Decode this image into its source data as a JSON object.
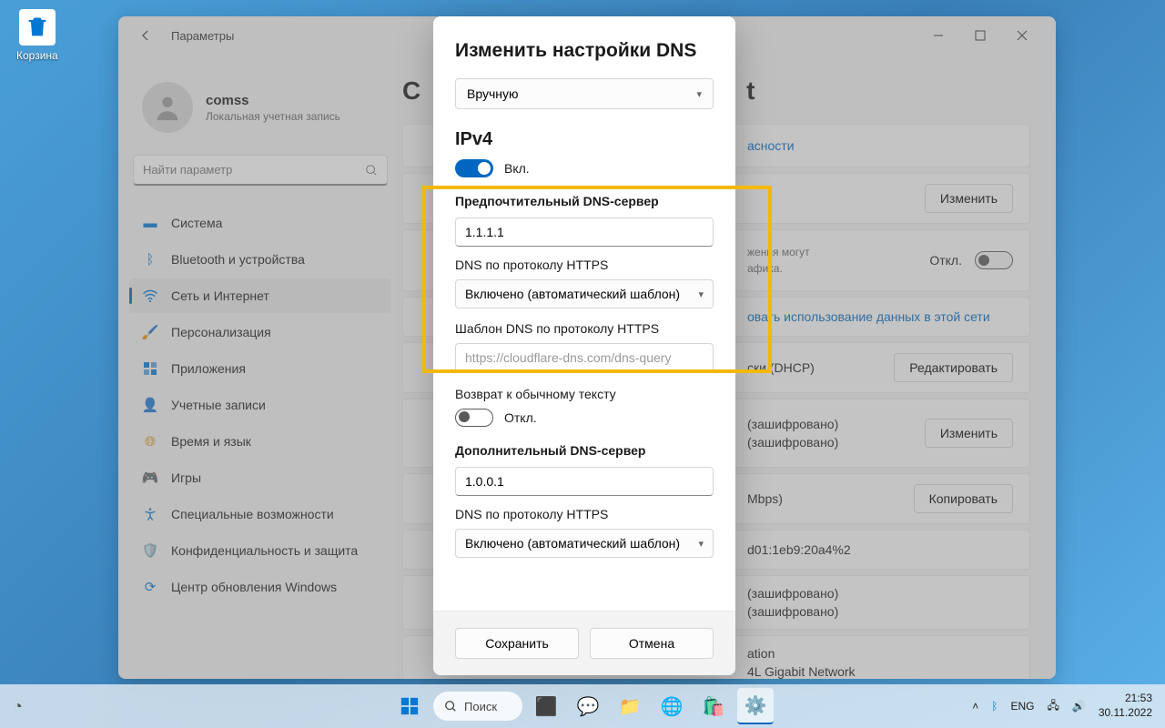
{
  "desktop": {
    "recycle_bin": "Корзина"
  },
  "window": {
    "title": "Параметры",
    "user": {
      "name": "comss",
      "subtitle": "Локальная учетная запись"
    },
    "search_placeholder": "Найти параметр",
    "nav": [
      {
        "label": "Система",
        "icon": "🖥️"
      },
      {
        "label": "Bluetooth и устройства",
        "icon": "bt"
      },
      {
        "label": "Сеть и Интернет",
        "icon": "wifi",
        "active": true
      },
      {
        "label": "Персонализация",
        "icon": "🖌️"
      },
      {
        "label": "Приложения",
        "icon": "apps"
      },
      {
        "label": "Учетные записи",
        "icon": "👤"
      },
      {
        "label": "Время и язык",
        "icon": "🌐"
      },
      {
        "label": "Игры",
        "icon": "🎮"
      },
      {
        "label": "Специальные возможности",
        "icon": "acc"
      },
      {
        "label": "Конфиденциальность и защита",
        "icon": "🛡️"
      },
      {
        "label": "Центр обновления Windows",
        "icon": "upd"
      }
    ],
    "page_title_partial": "C",
    "bg": {
      "security_link": "асности",
      "edit1": "Изменить",
      "metered_sub1": "жения могут",
      "metered_sub2": "афика.",
      "off_label": "Откл.",
      "data_usage_link": "овать использование данных в этой сети",
      "dhcp_label": "ски (DHCP)",
      "edit_btn": "Редактировать",
      "encrypted1": "(зашифровано)",
      "encrypted2": "(зашифровано)",
      "edit2": "Изменить",
      "mbps": "Mbps)",
      "copy_btn": "Копировать",
      "ipv6_addr": "d01:1eb9:20a4%2",
      "encrypted3": "(зашифровано)",
      "encrypted4": "(зашифровано)",
      "desc_label": "ation",
      "adapter": "4L Gigabit Network"
    }
  },
  "dialog": {
    "title": "Изменить настройки DNS",
    "mode_dropdown": "Вручную",
    "ipv4_heading": "IPv4",
    "ipv4_on": "Вкл.",
    "preferred_label": "Предпочтительный DNS-сервер",
    "preferred_value": "1.1.1.1",
    "doh_label": "DNS по протоколу HTTPS",
    "doh_value": "Включено (автоматический шаблон)",
    "template_label": "Шаблон DNS по протоколу HTTPS",
    "template_placeholder": "https://cloudflare-dns.com/dns-query",
    "fallback_label": "Возврат к обычному тексту",
    "fallback_off": "Откл.",
    "alternate_label": "Дополнительный DNS-сервер",
    "alternate_value": "1.0.0.1",
    "doh2_label": "DNS по протоколу HTTPS",
    "doh2_value": "Включено (автоматический шаблон)",
    "save": "Сохранить",
    "cancel": "Отмена"
  },
  "taskbar": {
    "search": "Поиск",
    "lang": "ENG",
    "time": "21:53",
    "date": "30.11.2022"
  }
}
